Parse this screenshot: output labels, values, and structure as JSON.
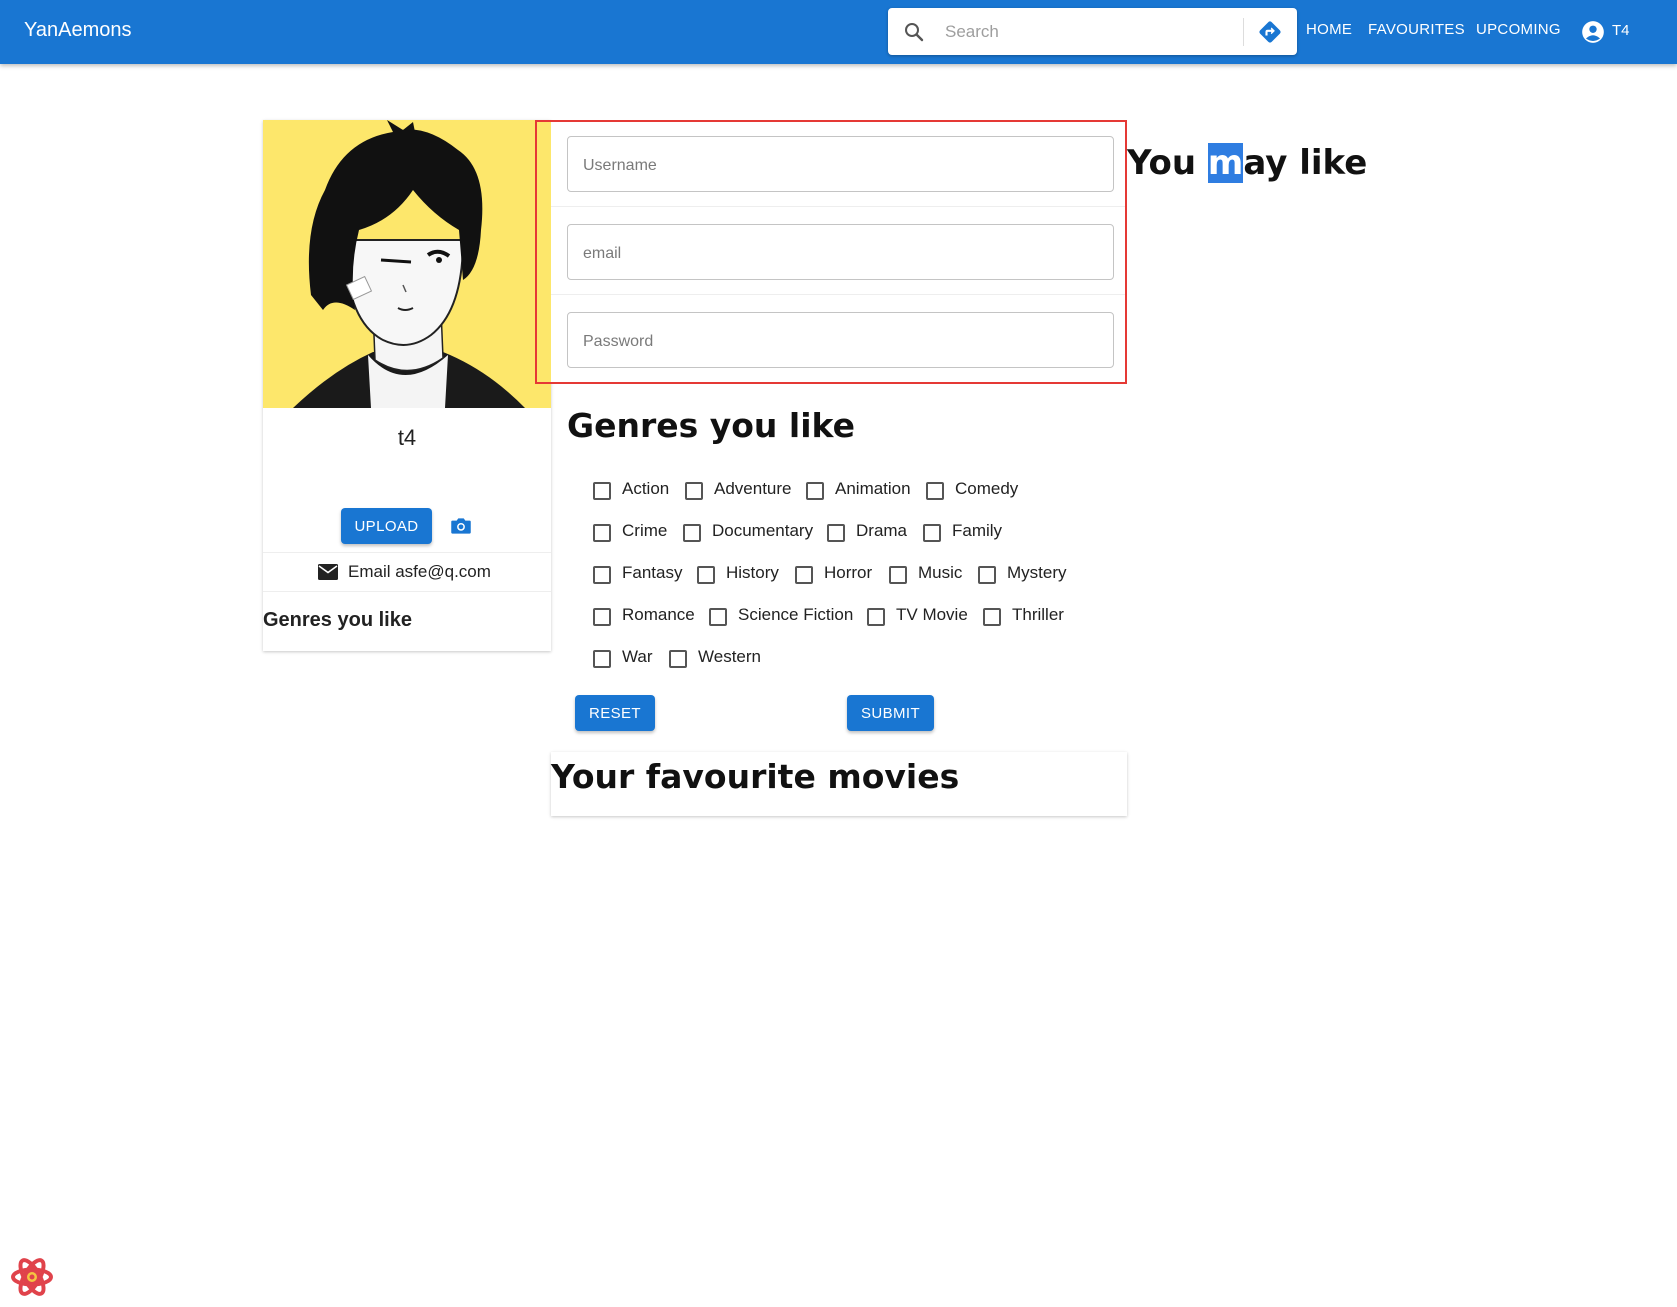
{
  "appbar": {
    "brand": "YanAemons",
    "search": {
      "placeholder": "Search",
      "icon": "search-icon",
      "direction_icon": "directions-icon"
    },
    "nav": [
      "HOME",
      "FAVOURITES",
      "UPCOMING"
    ],
    "account_label": "T4",
    "color": "#1976d2"
  },
  "profile": {
    "username": "t4",
    "upload_label": "UPLOAD",
    "email_text": "Email asfe@q.com",
    "genres_heading": "Genres you like",
    "avatar_background": "#fde76b"
  },
  "form": {
    "username_placeholder": "Username",
    "email_placeholder": "email",
    "password_placeholder": "Password",
    "genres_title": "Genres you like",
    "genres": [
      "Action",
      "Adventure",
      "Animation",
      "Comedy",
      "Crime",
      "Documentary",
      "Drama",
      "Family",
      "Fantasy",
      "History",
      "Horror",
      "Music",
      "Mystery",
      "Romance",
      "Science Fiction",
      "TV Movie",
      "Thriller",
      "War",
      "Western"
    ],
    "reset_label": "RESET",
    "submit_label": "SUBMIT",
    "highlight_color": "#e53935"
  },
  "favourites": {
    "title": "Your favourite movies"
  },
  "suggestions": {
    "title_before": "You ",
    "title_selected": "m",
    "title_after": "ay like"
  }
}
